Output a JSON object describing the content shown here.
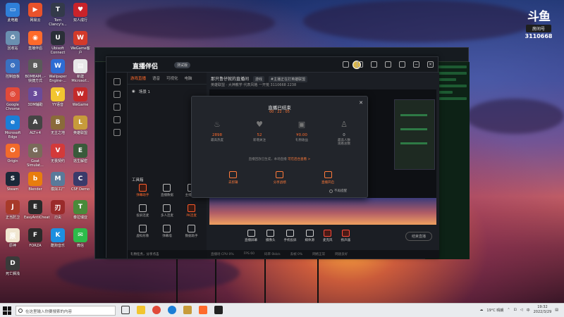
{
  "desktop_icons": [
    {
      "label": "此电脑",
      "color": "#2f7fd8",
      "glyph": "▭"
    },
    {
      "label": "网易云",
      "color": "#e8522b",
      "glyph": "▶"
    },
    {
      "label": "Tom Clancy's...",
      "color": "#333a4a",
      "glyph": "T"
    },
    {
      "label": "双人成行",
      "color": "#c9232a",
      "glyph": "♥"
    },
    {
      "label": "回收站",
      "color": "#6a8fb0",
      "glyph": "♻"
    },
    {
      "label": "直播伴侣",
      "color": "#ff6a2b",
      "glyph": "◉"
    },
    {
      "label": "Ubisoft Connect",
      "color": "#2a2f38",
      "glyph": "U"
    },
    {
      "label": "WeGame客户",
      "color": "#d33a2a",
      "glyph": "W"
    },
    {
      "label": "控制面板",
      "color": "#3a70c0",
      "glyph": "⚙"
    },
    {
      "label": "BOMBAM...-快捷方式",
      "color": "#5a5a5a",
      "glyph": "B"
    },
    {
      "label": "Wallpaper Engine-...",
      "color": "#2e6cd3",
      "glyph": "W"
    },
    {
      "label": "新建 Microsof...",
      "color": "#e8e8e8",
      "glyph": "▤"
    },
    {
      "label": "Google Chrome",
      "color": "#e14a3a",
      "glyph": "◎"
    },
    {
      "label": "3DM辅助",
      "color": "#6a4b9a",
      "glyph": "3"
    },
    {
      "label": "YY语音",
      "color": "#f2c530",
      "glyph": "Y"
    },
    {
      "label": "WeGame",
      "color": "#c42a2a",
      "glyph": "W"
    },
    {
      "label": "Microsoft Edge",
      "color": "#1b7ed6",
      "glyph": "e"
    },
    {
      "label": "ALT+4",
      "color": "#444",
      "glyph": "A"
    },
    {
      "label": "无主之地",
      "color": "#8a6a3a",
      "glyph": "B"
    },
    {
      "label": "英雄联盟",
      "color": "#c79b3b",
      "glyph": "L"
    },
    {
      "label": "Origin",
      "color": "#f26a2b",
      "glyph": "O"
    },
    {
      "label": "Goat Simulat...",
      "color": "#7a6a5a",
      "glyph": "G"
    },
    {
      "label": "无畏契约",
      "color": "#d33a3a",
      "glyph": "V"
    },
    {
      "label": "逃生解密",
      "color": "#3a5a3a",
      "glyph": "E"
    },
    {
      "label": "Steam",
      "color": "#1b2838",
      "glyph": "S"
    },
    {
      "label": "Blender",
      "color": "#e87d0d",
      "glyph": "b"
    },
    {
      "label": "模拟工厂",
      "color": "#5a7a9a",
      "glyph": "M"
    },
    {
      "label": "CSF Demo",
      "color": "#3a3a6a",
      "glyph": "C"
    },
    {
      "label": "正当防卫",
      "color": "#a83a2a",
      "glyph": "J"
    },
    {
      "label": "EasyAntiCheat",
      "color": "#2a2a2a",
      "glyph": "E"
    },
    {
      "label": "刃尖",
      "color": "#9a2a2a",
      "glyph": "刃"
    },
    {
      "label": "泰拉瑞亚",
      "color": "#4a8a3a",
      "glyph": "T"
    },
    {
      "label": "原神",
      "color": "#f0e6d0",
      "glyph": "原"
    },
    {
      "label": "FORZA",
      "color": "#2a2a2a",
      "glyph": "F"
    },
    {
      "label": "酷狗音乐",
      "color": "#1d8fe0",
      "glyph": "K"
    },
    {
      "label": "微信",
      "color": "#2dbb4a",
      "glyph": "✉"
    },
    {
      "label": "死亡搁浅",
      "color": "#3a3a3a",
      "glyph": "D"
    }
  ],
  "douyu": {
    "mark": "斗鱼",
    "room_label": "房间号",
    "room_id": "3110668"
  },
  "app": {
    "logo": "直播伴侣",
    "version": "测试版",
    "rail_icons": [
      "home-icon",
      "scene-icon",
      "layers-icon",
      "settings-icon",
      "help-icon"
    ],
    "tabs": [
      {
        "label": "游戏直播",
        "active": true
      },
      {
        "label": "语音",
        "active": false
      },
      {
        "label": "可视化",
        "active": false
      },
      {
        "label": "电脑",
        "active": false
      }
    ],
    "scene": "场景 1",
    "tools_title": "工具箱",
    "tools": [
      {
        "label": "弹幕助手",
        "hot": true
      },
      {
        "label": "直播数据",
        "hot": false
      },
      {
        "label": "主播任务",
        "hot": false
      },
      {
        "label": "投屏连麦",
        "hot": false
      },
      {
        "label": "多人连麦",
        "hot": false
      },
      {
        "label": "PK连麦",
        "hot": true
      },
      {
        "label": "虚拟形象",
        "hot": false
      },
      {
        "label": "弹幕墙",
        "hot": false
      },
      {
        "label": "数据助手",
        "hot": false
      }
    ],
    "left_footer": "礼物任务，分享点击",
    "room_title": "那只鲁仔就的直播间",
    "room_tag": "游戏",
    "room_category": "#主播正在打英雄联盟",
    "room_meta": "英雄联盟 · 大神教学  代表风格 一开荒  3110668  2238",
    "bottom_tools": [
      {
        "label": "直播屏幕",
        "hot": false
      },
      {
        "label": "摄像头",
        "hot": false
      },
      {
        "label": "手机投屏",
        "hot": false
      },
      {
        "label": "媒体源",
        "hot": false
      },
      {
        "label": "麦克风",
        "hot": true
      },
      {
        "label": "扬声器",
        "hot": true
      }
    ],
    "end_live": "结束直播",
    "status": [
      "直播场 CPU 0%",
      "FPS 60",
      "码率 0kb/s",
      "丢帧 0%",
      "网络正常",
      "网速良好"
    ]
  },
  "modal": {
    "title": "直播已结束",
    "time": "00 : 22 : 05",
    "stats": [
      {
        "value": "2898",
        "label": "最高热度",
        "icon": "flame-icon",
        "highlight": true
      },
      {
        "value": "52",
        "label": "新增关注",
        "icon": "heart-icon",
        "highlight": true
      },
      {
        "value": "¥0.00",
        "label": "礼物收益",
        "icon": "gift-icon",
        "highlight": true
      },
      {
        "value": "0",
        "label": "最高人数\n观看总数",
        "icon": "people-icon",
        "highlight": false
      }
    ],
    "hint_text": "直播回放已生成，本场直播",
    "hint_link": "可在后台查看 >",
    "actions": [
      {
        "label": "去剪辑",
        "icon": "scissors-icon"
      },
      {
        "label": "分享战绩",
        "icon": "share-icon"
      },
      {
        "label": "直播开启",
        "icon": "edit-icon"
      }
    ],
    "checkbox_label": "不再提醒"
  },
  "taskbar": {
    "search_placeholder": "在这里输入你要搜索的内容",
    "weather": "19°C 晴朗",
    "time": "19:32",
    "date": "2022/3/29"
  }
}
